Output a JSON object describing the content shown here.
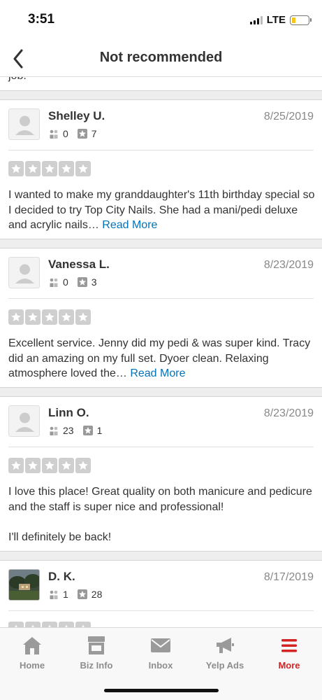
{
  "status_bar": {
    "time": "3:51",
    "network": "LTE"
  },
  "nav": {
    "title": "Not recommended"
  },
  "prev_review_tail": "job.",
  "reviews": [
    {
      "name": "Shelley U.",
      "date": "8/25/2019",
      "friends": "0",
      "reviews_count": "7",
      "rating": 5,
      "text": "I wanted to make my granddaughter's 11th birthday special so I decided to try Top City Nails. She had a mani/pedi deluxe and acrylic nails…",
      "read_more": "Read More"
    },
    {
      "name": "Vanessa L.",
      "date": "8/23/2019",
      "friends": "0",
      "reviews_count": "3",
      "rating": 5,
      "text": "Excellent service. Jenny did my pedi & was super kind. Tracy did an amazing on my full set. Dyoer clean. Relaxing atmosphere loved the…",
      "read_more": "Read More"
    },
    {
      "name": "Linn O.",
      "date": "8/23/2019",
      "friends": "23",
      "reviews_count": "1",
      "rating": 5,
      "text_p1": "I love this place! Great quality on both manicure and pedicure and the staff is super nice and professional!",
      "text_p2": "I'll definitely be back!"
    },
    {
      "name": "D. K.",
      "date": "8/17/2019",
      "friends": "1",
      "reviews_count": "28",
      "rating": 5
    }
  ],
  "tabs": [
    {
      "label": "Home",
      "icon": "home-icon"
    },
    {
      "label": "Biz Info",
      "icon": "store-icon"
    },
    {
      "label": "Inbox",
      "icon": "envelope-icon"
    },
    {
      "label": "Yelp Ads",
      "icon": "megaphone-icon"
    },
    {
      "label": "More",
      "icon": "menu-icon",
      "active": true
    }
  ],
  "colors": {
    "accent": "#d32323",
    "link": "#0073bb",
    "star_gray": "#cfcfcf"
  }
}
